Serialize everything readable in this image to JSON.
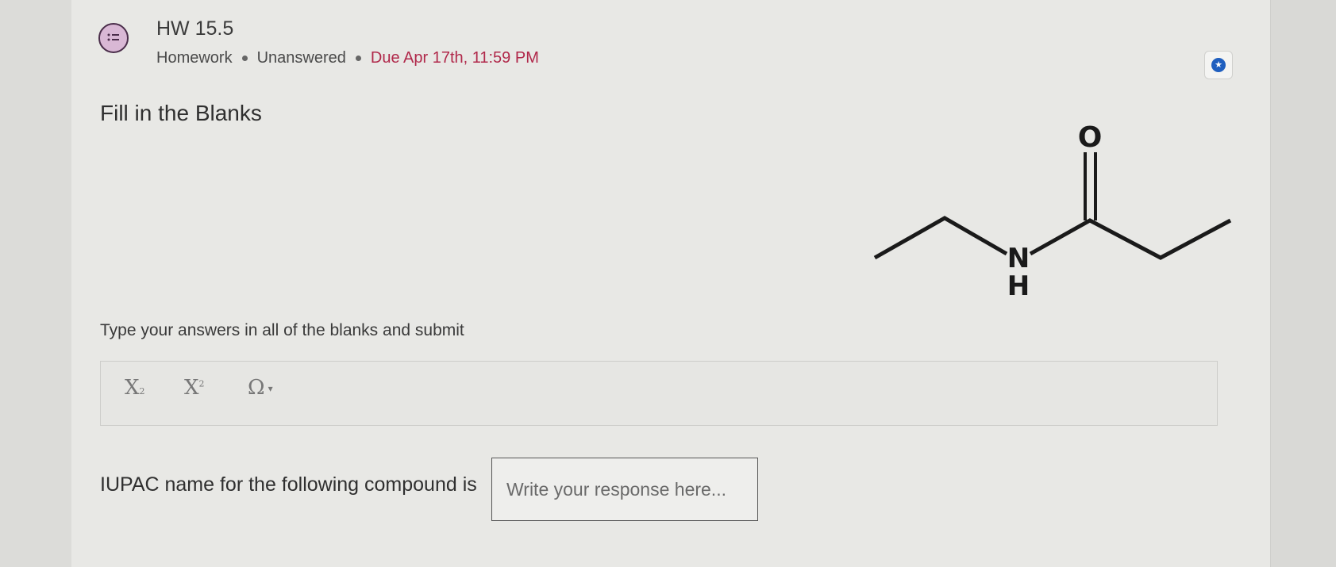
{
  "header": {
    "title": "HW 15.5",
    "type": "Homework",
    "status": "Unanswered",
    "due": "Due Apr 17th, 11:59 PM",
    "icon": "discussion-list-icon"
  },
  "bookmark": {
    "icon": "star-icon"
  },
  "question": {
    "section_title": "Fill in the Blanks",
    "instructions": "Type your answers in all of the blanks and submit",
    "prompt": "IUPAC name for the following compound is",
    "answer": {
      "value": "",
      "placeholder": "Write your response here..."
    }
  },
  "toolbar": {
    "subscript": "X",
    "superscript": "X",
    "special_chars": "Ω",
    "subscript_mark": "2",
    "superscript_mark": "2"
  },
  "molecule": {
    "atom_o": "O",
    "atom_n": "N",
    "atom_h": "H"
  },
  "colors": {
    "accent": "#b0284a",
    "icon_fill": "#d9b8d5",
    "bookmark": "#1f5fbf"
  }
}
